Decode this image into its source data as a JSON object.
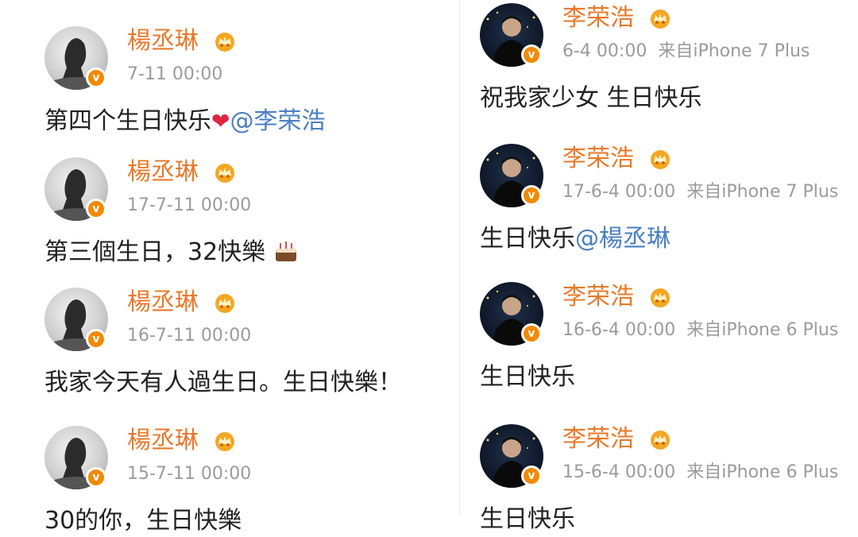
{
  "left_column": {
    "posts": [
      {
        "user": "楊丞琳",
        "time": "7-11 00:00",
        "text": "第四个生日快乐",
        "emoji": "❤",
        "mention": "@李荣浩"
      },
      {
        "user": "楊丞琳",
        "time": "17-7-11 00:00",
        "text": "第三個生日，32快樂",
        "emoji": "cake-icon"
      },
      {
        "user": "楊丞琳",
        "time": "16-7-11 00:00",
        "text": "我家今天有人過生日。生日快樂！"
      },
      {
        "user": "楊丞琳",
        "time": "15-7-11 00:00",
        "text": "30的你，生日快樂"
      }
    ]
  },
  "right_column": {
    "posts": [
      {
        "user": "李荣浩",
        "time": "6-4 00:00",
        "source": "来自iPhone 7 Plus",
        "text": "祝我家少女 生日快乐"
      },
      {
        "user": "李荣浩",
        "time": "17-6-4 00:00",
        "source": "来自iPhone 7 Plus",
        "text": "生日快乐",
        "mention": "@楊丞琳"
      },
      {
        "user": "李荣浩",
        "time": "16-6-4 00:00",
        "source": "来自iPhone 6 Plus",
        "text": "生日快乐"
      },
      {
        "user": "李荣浩",
        "time": "15-6-4 00:00",
        "source": "来自iPhone 6 Plus",
        "text": "生日快乐"
      }
    ]
  },
  "badge_letter": "v",
  "colors": {
    "name": "#e8792a",
    "mention": "#4a7fc1",
    "meta": "#9b9b9b",
    "badge": "#f28a00",
    "heart": "#e0263f"
  }
}
